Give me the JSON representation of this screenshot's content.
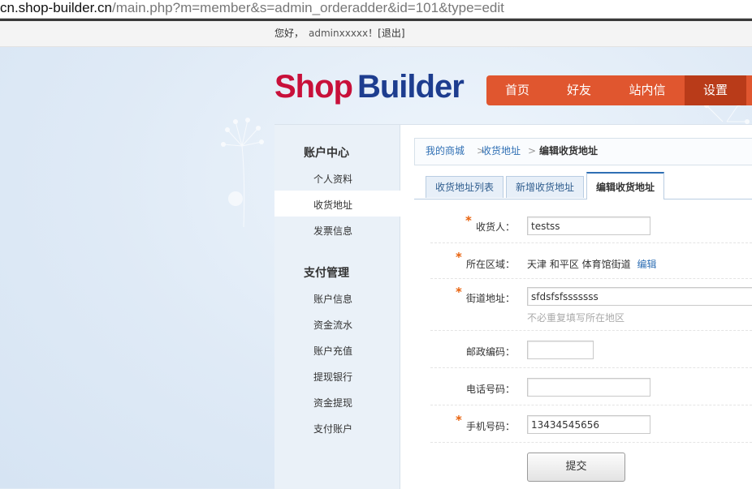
{
  "browser": {
    "url_host": "cn.shop-builder.cn",
    "url_path": "/main.php?m=member&s=admin_orderadder&id=101&type=edit"
  },
  "userbar": {
    "greeting": "您好，",
    "username": "adminxxxxx",
    "exclaim": "！",
    "logout": "[退出]"
  },
  "logo": {
    "part1": "Shop",
    "part2": "Builder"
  },
  "nav": {
    "items": [
      {
        "label": "首页"
      },
      {
        "label": "好友"
      },
      {
        "label": "站内信"
      },
      {
        "label": "设置",
        "active": true
      }
    ]
  },
  "sidebar": {
    "sections": [
      {
        "title": "账户中心",
        "links": [
          "个人资料",
          "收货地址",
          "发票信息"
        ]
      },
      {
        "title": "支付管理",
        "links": [
          "账户信息",
          "资金流水",
          "账户充值",
          "提现银行",
          "资金提现",
          "支付账户"
        ]
      }
    ],
    "active_link": "收货地址"
  },
  "breadcrumb": {
    "items": [
      "我的商城",
      "收货地址"
    ],
    "current": "编辑收货地址",
    "separator": ">"
  },
  "tabs": [
    {
      "label": "收货地址列表"
    },
    {
      "label": "新增收货地址"
    },
    {
      "label": "编辑收货地址",
      "active": true
    }
  ],
  "form": {
    "recipient": {
      "label": "收货人：",
      "value": "testss",
      "required": true
    },
    "region": {
      "label": "所在区域：",
      "value": "天津 和平区 体育馆街道",
      "edit_link": "编辑",
      "required": true
    },
    "street": {
      "label": "街道地址：",
      "value": "sfdsfsfsssssss",
      "hint": "不必重复填写所在地区",
      "required": true
    },
    "postcode": {
      "label": "邮政编码：",
      "value": ""
    },
    "phone": {
      "label": "电话号码：",
      "value": ""
    },
    "mobile": {
      "label": "手机号码：",
      "value": "13434545656",
      "required": true
    },
    "required_mark": "*",
    "submit_label": "提交"
  },
  "colors": {
    "nav_bg": "#e0562f",
    "nav_active": "#b93b19",
    "link": "#2f6fb4",
    "required": "#e8620d",
    "logo_red": "#c8103a",
    "logo_blue": "#1d3d8f"
  }
}
